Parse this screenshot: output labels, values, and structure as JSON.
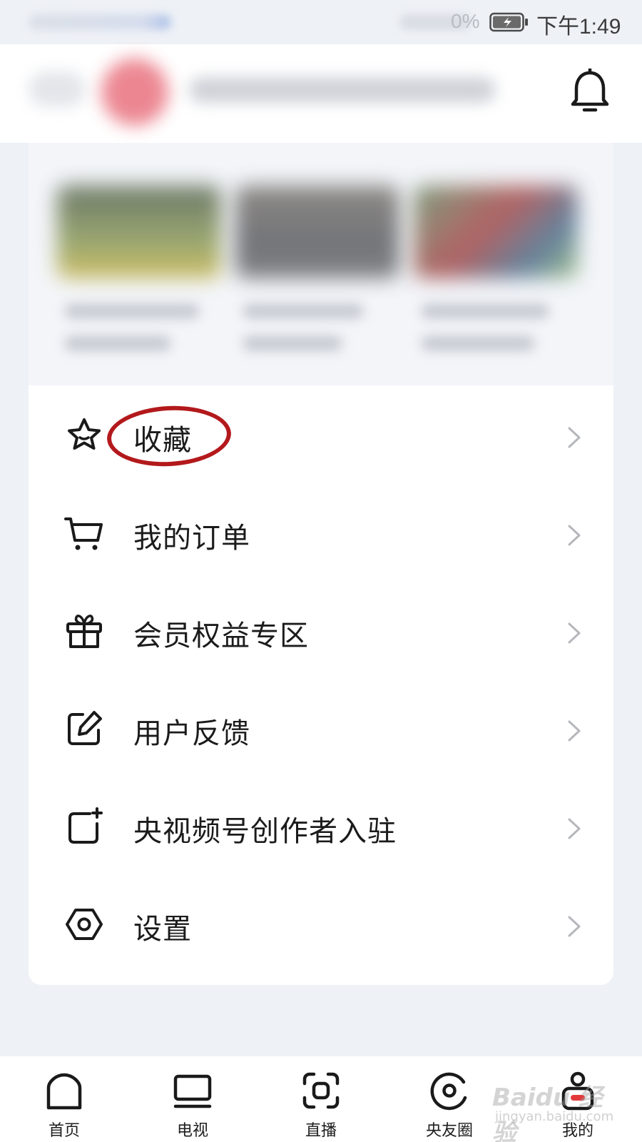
{
  "status_bar": {
    "battery_percent": "0%",
    "time": "下午1:49",
    "battery_icon": "battery-charging-icon"
  },
  "header": {
    "bell_icon": "bell-icon"
  },
  "menu": {
    "items": [
      {
        "label": "收藏",
        "icon": "star-icon"
      },
      {
        "label": "我的订单",
        "icon": "cart-icon"
      },
      {
        "label": "会员权益专区",
        "icon": "gift-icon"
      },
      {
        "label": "用户反馈",
        "icon": "edit-icon"
      },
      {
        "label": "央视频号创作者入驻",
        "icon": "add-square-icon"
      },
      {
        "label": "设置",
        "icon": "hexagon-settings-icon"
      }
    ],
    "highlight_color": "#b3191c"
  },
  "bottom_nav": {
    "items": [
      {
        "label": "首页",
        "icon": "home-icon"
      },
      {
        "label": "电视",
        "icon": "tv-icon"
      },
      {
        "label": "直播",
        "icon": "live-icon"
      },
      {
        "label": "央友圈",
        "icon": "circle-icon"
      },
      {
        "label": "我的",
        "icon": "profile-icon"
      }
    ]
  },
  "watermark": {
    "main": "Baidu 经验",
    "sub": "jingyan.baidu.com"
  }
}
